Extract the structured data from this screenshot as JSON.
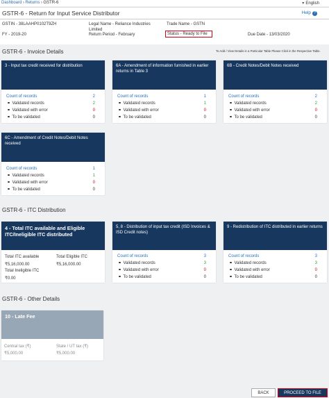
{
  "breadcrumb": {
    "items": [
      "Dashboard",
      "Returns"
    ],
    "current": "GSTR-6",
    "separator": "›"
  },
  "language": "English",
  "header": {
    "title": "GSTR-6 - Return for Input Service Distributor",
    "help": "Help",
    "help_icon": "?",
    "gstin": "GSTIN - 38LAAHP0102T9ZH",
    "legal_name": "Legal Name - Reliance Industries Limited",
    "trade_name": "Trade Name - GSTN",
    "fy": "FY - 2019-20",
    "return_period": "Return Period - February",
    "status": "Status - Ready to File",
    "due_date": "Due Date - 13/03/2020"
  },
  "sections": {
    "invoice": "GSTR-6 - Invoice Details",
    "itc": "GSTR-6 - ITC Distribution",
    "other": "GSTR-6 - Other Details"
  },
  "add_note": "To Add / View Details in a Particular Table Please Click in the Respective Table.",
  "labels": {
    "count": "Count of records",
    "validated": "Validated records",
    "error": "Validated with error",
    "to_validate": "To be validated"
  },
  "tiles": {
    "t3": {
      "title": "3 - Input tax credit received for distribution",
      "count": "2",
      "validated": "2",
      "error": "0",
      "to_validate": "0"
    },
    "t6a": {
      "title": "6A - Amendment of information furnished in earlier returns in Table 3",
      "count": "1",
      "validated": "1",
      "error": "0",
      "to_validate": "0"
    },
    "t6b": {
      "title": "6B - Credit Notes/Debit Notes received",
      "count": "2",
      "validated": "2",
      "error": "0",
      "to_validate": "0"
    },
    "t6c": {
      "title": "6C - Amendment of Credit Notes/Debit Notes received",
      "count": "1",
      "validated": "1",
      "error": "0",
      "to_validate": "0"
    },
    "t4": {
      "title": "4 - Total ITC available and Eligible ITC/Ineligible ITC distributed",
      "total_itc_label": "Total ITC available",
      "total_itc": "₹5,16,000.00",
      "eligible_label": "Total Eligible ITC",
      "eligible": "₹5,16,000.00",
      "ineligible_label": "Total Ineligible ITC",
      "ineligible": "₹0.00"
    },
    "t58": {
      "title": "5, 8 - Distribution of input tax credit (ISD Invoices & ISD Credit notes)",
      "count": "3",
      "validated": "3",
      "error": "0",
      "to_validate": "0"
    },
    "t9": {
      "title": "9 - Redistribution of ITC distributed in earlier returns",
      "count": "3",
      "validated": "3",
      "error": "0",
      "to_validate": "0"
    },
    "t10": {
      "title": "10 - Late Fee",
      "central_label": "Central tax (₹)",
      "central": "₹5,000.00",
      "state_label": "State / UT tax (₹)",
      "state": "₹5,000.00"
    }
  },
  "buttons": {
    "back": "BACK",
    "proceed": "PROCEED TO FILE"
  },
  "colors": {
    "header_blue": "#17375e",
    "link_blue": "#2a6fb6",
    "success_green": "#2e9e3e",
    "error_red": "#d0021b",
    "disabled_grey": "#98a7b5"
  }
}
